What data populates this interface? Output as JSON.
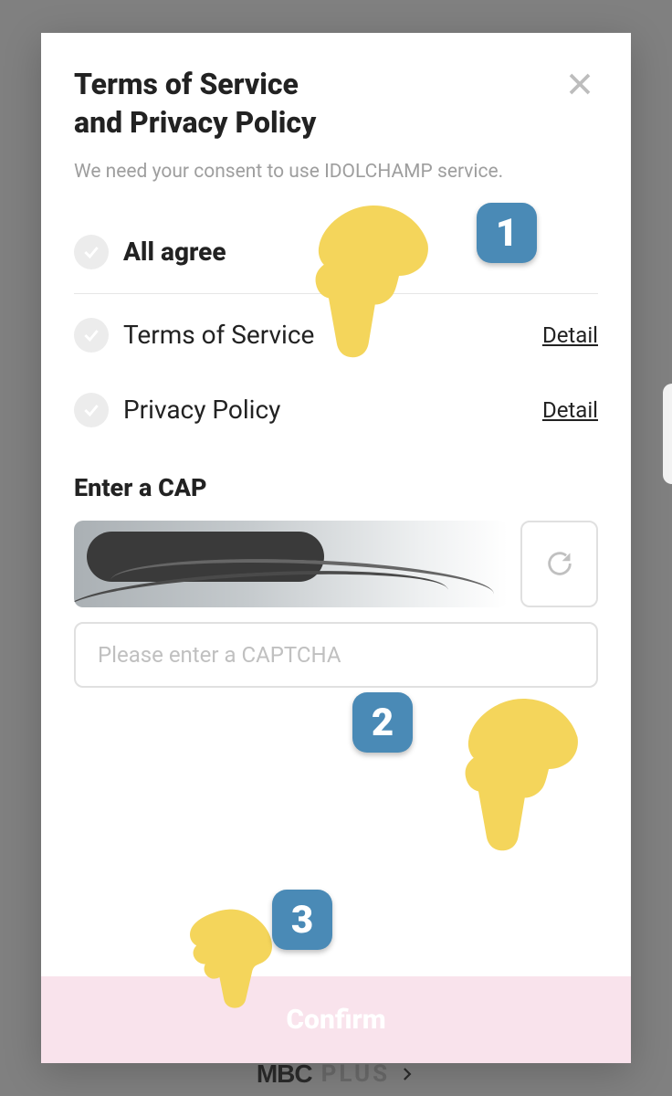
{
  "modal": {
    "title": "Terms of Service\nand Privacy Policy",
    "subtitle": "We need your consent to use IDOLCHAMP service.",
    "all_agree_label": "All agree",
    "tos_label": "Terms of Service",
    "pp_label": "Privacy Policy",
    "detail_label": "Detail",
    "captcha": {
      "heading": "Enter a CAP",
      "placeholder": "Please enter a CAPTCHA"
    },
    "confirm_label": "Confirm"
  },
  "annotations": {
    "one": "1",
    "two": "2",
    "three": "3"
  },
  "background": {
    "brand_mbc": "MBC",
    "brand_plus": "PLUS"
  }
}
